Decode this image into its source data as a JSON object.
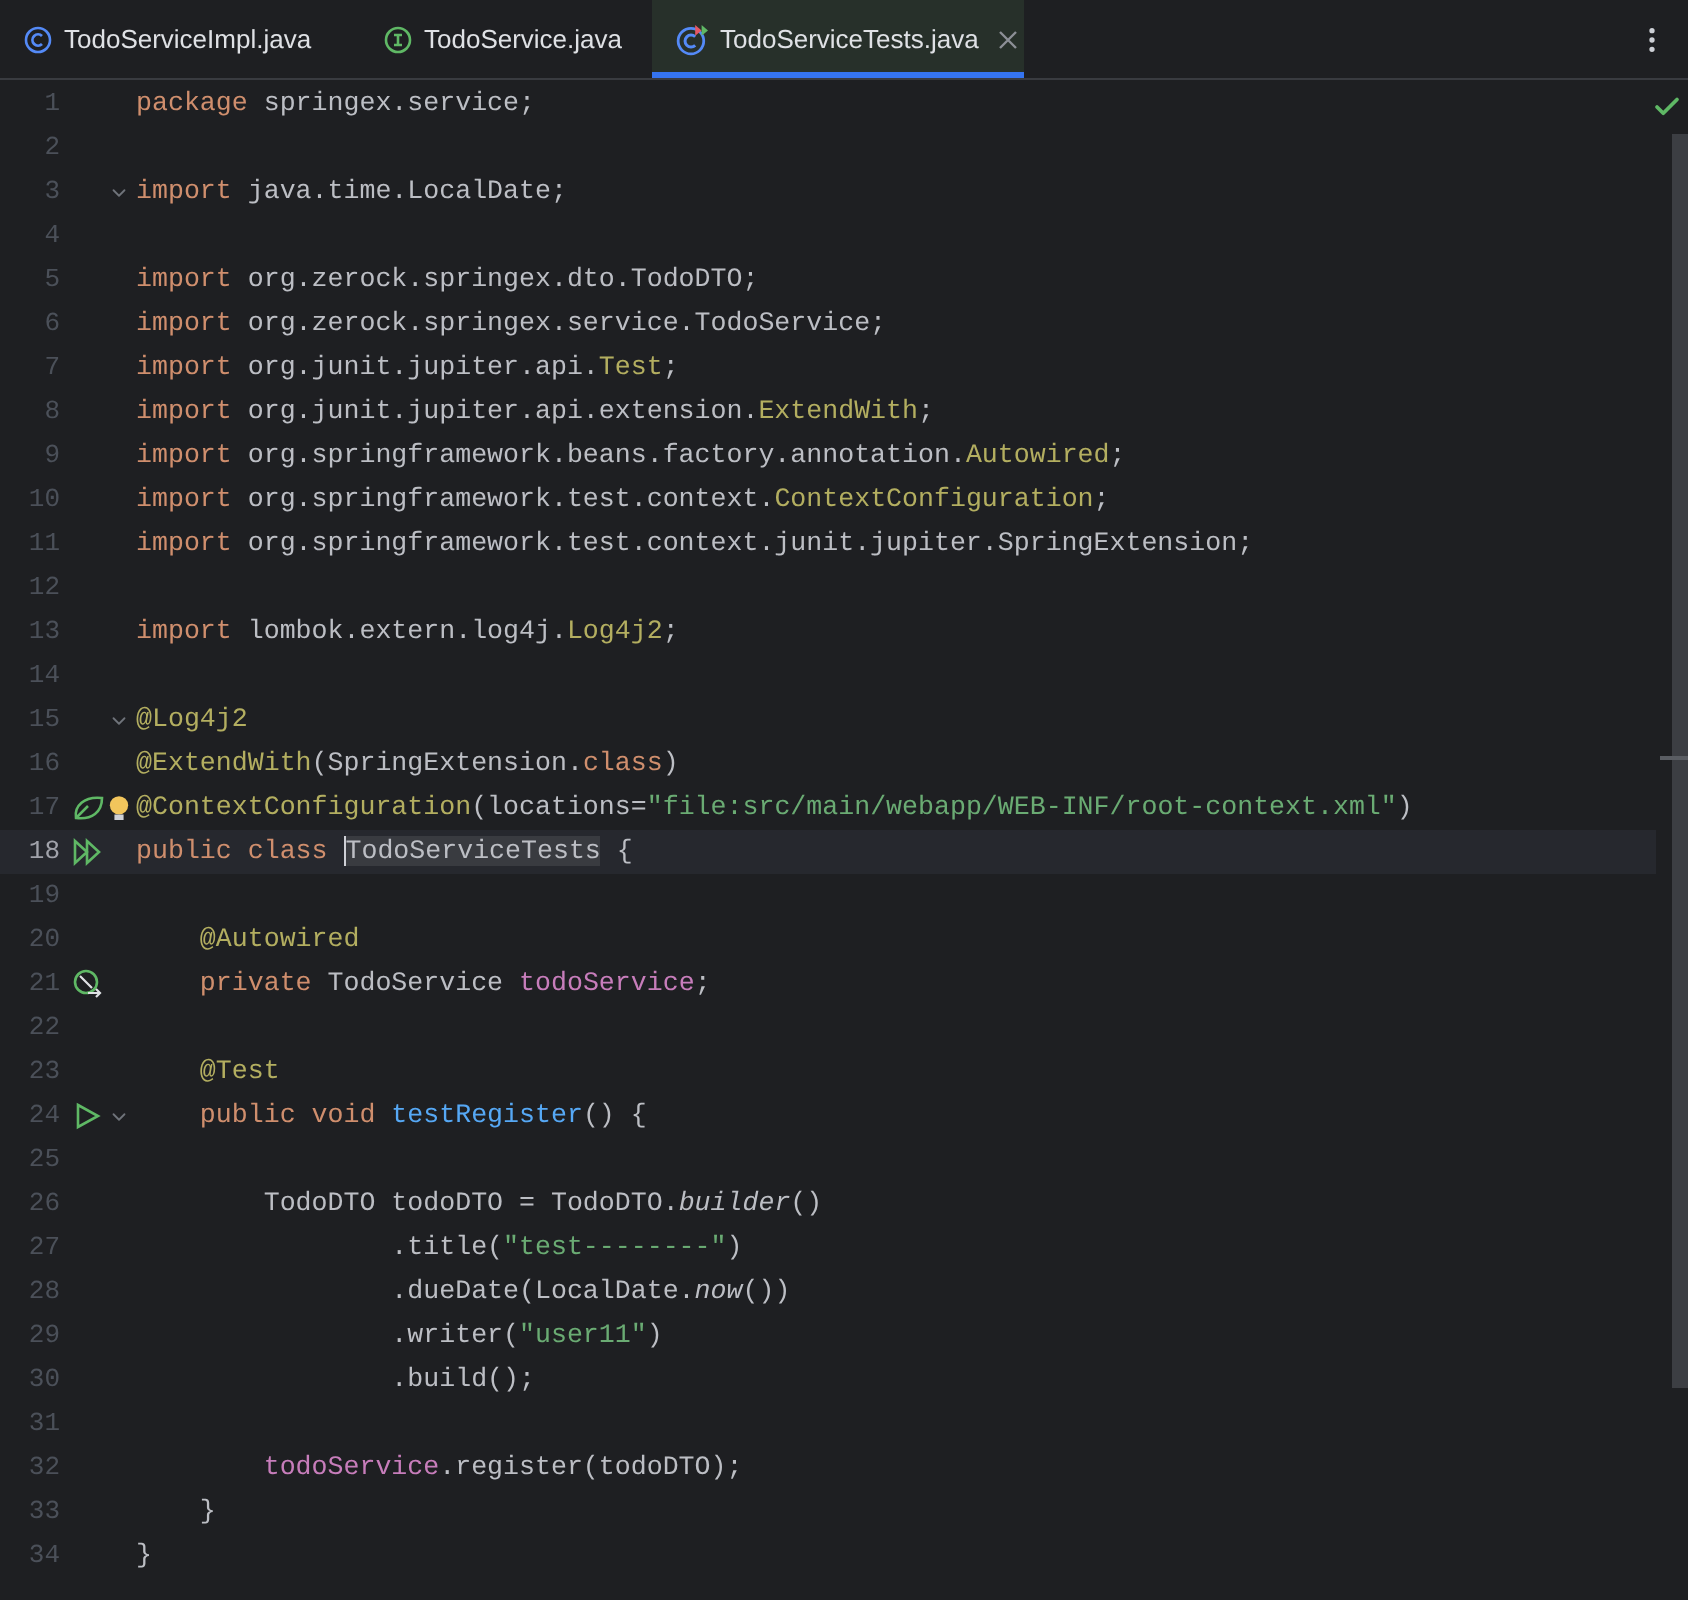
{
  "tabs": [
    {
      "label": "TodoServiceImpl.java",
      "kind": "class",
      "selected": false,
      "closable": false
    },
    {
      "label": "TodoService.java",
      "kind": "interface",
      "selected": false,
      "closable": false
    },
    {
      "label": "TodoServiceTests.java",
      "kind": "test-class",
      "selected": true,
      "closable": true
    }
  ],
  "editor": {
    "inspection_ok": true,
    "lines": [
      {
        "number": "1",
        "tokens": [
          {
            "kind": "kw",
            "t": "package "
          },
          {
            "kind": "plain",
            "t": "springex.service;"
          }
        ]
      },
      {
        "number": "2"
      },
      {
        "number": "3",
        "fold": true,
        "tokens": [
          {
            "kind": "kw",
            "t": "import "
          },
          {
            "kind": "plain",
            "t": "java.time.LocalDate;"
          }
        ]
      },
      {
        "number": "4"
      },
      {
        "number": "5",
        "tokens": [
          {
            "kind": "kw",
            "t": "import "
          },
          {
            "kind": "plain",
            "t": "org.zerock.springex.dto.TodoDTO;"
          }
        ]
      },
      {
        "number": "6",
        "tokens": [
          {
            "kind": "kw",
            "t": "import "
          },
          {
            "kind": "plain",
            "t": "org.zerock.springex.service.TodoService;"
          }
        ]
      },
      {
        "number": "7",
        "tokens": [
          {
            "kind": "kw",
            "t": "import "
          },
          {
            "kind": "plain",
            "t": "org.junit.jupiter.api."
          },
          {
            "kind": "anno",
            "t": "Test"
          },
          {
            "kind": "plain",
            "t": ";"
          }
        ]
      },
      {
        "number": "8",
        "tokens": [
          {
            "kind": "kw",
            "t": "import "
          },
          {
            "kind": "plain",
            "t": "org.junit.jupiter.api.extension."
          },
          {
            "kind": "anno",
            "t": "ExtendWith"
          },
          {
            "kind": "plain",
            "t": ";"
          }
        ]
      },
      {
        "number": "9",
        "tokens": [
          {
            "kind": "kw",
            "t": "import "
          },
          {
            "kind": "plain",
            "t": "org.springframework.beans.factory.annotation."
          },
          {
            "kind": "anno",
            "t": "Autowired"
          },
          {
            "kind": "plain",
            "t": ";"
          }
        ]
      },
      {
        "number": "10",
        "tokens": [
          {
            "kind": "kw",
            "t": "import "
          },
          {
            "kind": "plain",
            "t": "org.springframework.test.context."
          },
          {
            "kind": "anno",
            "t": "ContextConfiguration"
          },
          {
            "kind": "plain",
            "t": ";"
          }
        ]
      },
      {
        "number": "11",
        "tokens": [
          {
            "kind": "kw",
            "t": "import "
          },
          {
            "kind": "plain",
            "t": "org.springframework.test.context.junit.jupiter.SpringExtension;"
          }
        ]
      },
      {
        "number": "12"
      },
      {
        "number": "13",
        "tokens": [
          {
            "kind": "kw",
            "t": "import "
          },
          {
            "kind": "plain",
            "t": "lombok.extern.log4j."
          },
          {
            "kind": "anno",
            "t": "Log4j2"
          },
          {
            "kind": "plain",
            "t": ";"
          }
        ]
      },
      {
        "number": "14"
      },
      {
        "number": "15",
        "fold": true,
        "tokens": [
          {
            "kind": "anno",
            "t": "@Log4j2"
          }
        ]
      },
      {
        "number": "16",
        "tokens": [
          {
            "kind": "anno",
            "t": "@ExtendWith"
          },
          {
            "kind": "plain",
            "t": "(SpringExtension."
          },
          {
            "kind": "kw",
            "t": "class"
          },
          {
            "kind": "plain",
            "t": ")"
          }
        ]
      },
      {
        "number": "17",
        "gutter": {
          "kind": "bean"
        },
        "bulb": true,
        "tokens": [
          {
            "kind": "anno",
            "t": "@ContextConfiguration"
          },
          {
            "kind": "plain",
            "t": "(locations="
          },
          {
            "kind": "str",
            "t": "\"file:src/main/webapp/WEB-INF/root-context.xml\""
          },
          {
            "kind": "plain",
            "t": ")"
          }
        ]
      },
      {
        "number": "18",
        "gutter": {
          "kind": "run-all"
        },
        "current": true,
        "tokens": [
          {
            "kind": "kw",
            "t": "public class "
          },
          {
            "kind": "hl",
            "t": "TodoServiceTests"
          },
          {
            "kind": "plain",
            "t": " {"
          }
        ]
      },
      {
        "number": "19"
      },
      {
        "number": "20",
        "tokens": [
          {
            "kind": "anno",
            "t": "    @Autowired"
          }
        ]
      },
      {
        "number": "21",
        "gutter": {
          "kind": "autowired"
        },
        "tokens": [
          {
            "kind": "kw",
            "t": "    private "
          },
          {
            "kind": "plain",
            "t": "TodoService "
          },
          {
            "kind": "field",
            "t": "todoService"
          },
          {
            "kind": "plain",
            "t": ";"
          }
        ]
      },
      {
        "number": "22"
      },
      {
        "number": "23",
        "tokens": [
          {
            "kind": "anno",
            "t": "    @Test"
          }
        ]
      },
      {
        "number": "24",
        "gutter": {
          "kind": "run"
        },
        "fold": true,
        "tokens": [
          {
            "kind": "kw",
            "t": "    public void "
          },
          {
            "kind": "method",
            "t": "testRegister"
          },
          {
            "kind": "plain",
            "t": "() {"
          }
        ]
      },
      {
        "number": "25"
      },
      {
        "number": "26",
        "tokens": [
          {
            "kind": "plain",
            "t": "        TodoDTO todoDTO = TodoDTO."
          },
          {
            "kind": "italic",
            "t": "builder"
          },
          {
            "kind": "plain",
            "t": "()"
          }
        ]
      },
      {
        "number": "27",
        "tokens": [
          {
            "kind": "plain",
            "t": "                .title("
          },
          {
            "kind": "str",
            "t": "\"test--------\""
          },
          {
            "kind": "plain",
            "t": ")"
          }
        ]
      },
      {
        "number": "28",
        "tokens": [
          {
            "kind": "plain",
            "t": "                .dueDate(LocalDate."
          },
          {
            "kind": "italic",
            "t": "now"
          },
          {
            "kind": "plain",
            "t": "())"
          }
        ]
      },
      {
        "number": "29",
        "tokens": [
          {
            "kind": "plain",
            "t": "                .writer("
          },
          {
            "kind": "str",
            "t": "\"user11\""
          },
          {
            "kind": "plain",
            "t": ")"
          }
        ]
      },
      {
        "number": "30",
        "tokens": [
          {
            "kind": "plain",
            "t": "                .build();"
          }
        ]
      },
      {
        "number": "31"
      },
      {
        "number": "32",
        "tokens": [
          {
            "kind": "field",
            "t": "        todoService"
          },
          {
            "kind": "plain",
            "t": ".register(todoDTO);"
          }
        ]
      },
      {
        "number": "33",
        "tokens": [
          {
            "kind": "plain",
            "t": "    }"
          }
        ]
      },
      {
        "number": "34",
        "tokens": [
          {
            "kind": "plain",
            "t": "}"
          }
        ]
      }
    ]
  }
}
